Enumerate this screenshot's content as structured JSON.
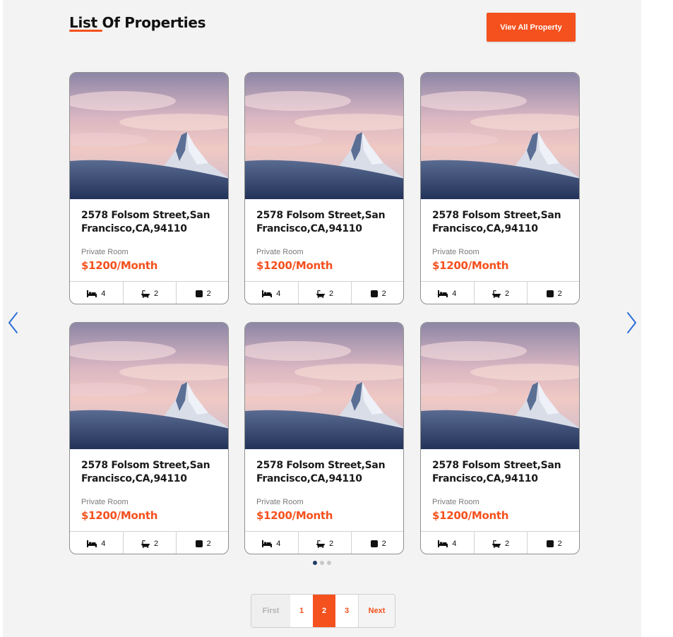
{
  "header": {
    "title": "List Of Properties",
    "view_all_label": "Viev All Property"
  },
  "colors": {
    "accent": "#f4511e",
    "arrow": "#2f6fd6"
  },
  "properties": [
    {
      "address": "2578 Folsom Street,San Francisco,CA,94110",
      "type": "Private Room",
      "price": "$1200/Month",
      "beds": "4",
      "baths": "2",
      "area": "2"
    },
    {
      "address": "2578 Folsom Street,San Francisco,CA,94110",
      "type": "Private Room",
      "price": "$1200/Month",
      "beds": "4",
      "baths": "2",
      "area": "2"
    },
    {
      "address": "2578 Folsom Street,San Francisco,CA,94110",
      "type": "Private Room",
      "price": "$1200/Month",
      "beds": "4",
      "baths": "2",
      "area": "2"
    },
    {
      "address": "2578 Folsom Street,San Francisco,CA,94110",
      "type": "Private Room",
      "price": "$1200/Month",
      "beds": "4",
      "baths": "2",
      "area": "2"
    },
    {
      "address": "2578 Folsom Street,San Francisco,CA,94110",
      "type": "Private Room",
      "price": "$1200/Month",
      "beds": "4",
      "baths": "2",
      "area": "2"
    },
    {
      "address": "2578 Folsom Street,San Francisco,CA,94110",
      "type": "Private Room",
      "price": "$1200/Month",
      "beds": "4",
      "baths": "2",
      "area": "2"
    }
  ],
  "icons": {
    "beds": "bed-icon",
    "baths": "bathtub-icon",
    "area": "area-square-icon",
    "prev": "chevron-left-icon",
    "next": "chevron-right-icon"
  },
  "carousel": {
    "dot_count": 3,
    "active_dot": 0
  },
  "pagination": {
    "first_label": "First",
    "pages": [
      "1",
      "2",
      "3"
    ],
    "active_page": "2",
    "next_label": "Next"
  }
}
